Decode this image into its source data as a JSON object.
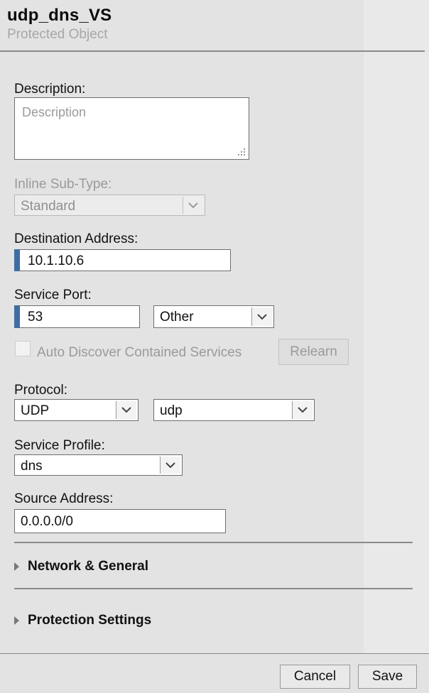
{
  "header": {
    "title": "udp_dns_VS",
    "subtitle": "Protected Object"
  },
  "description": {
    "label": "Description:",
    "placeholder": "Description",
    "value": ""
  },
  "inline_subtype": {
    "label": "Inline Sub-Type:",
    "value": "Standard",
    "disabled": true
  },
  "destination": {
    "label": "Destination Address:",
    "value": "10.1.10.6"
  },
  "service_port": {
    "label": "Service Port:",
    "value": "53",
    "select_value": "Other"
  },
  "auto_discover": {
    "label": "Auto Discover Contained Services",
    "button": "Relearn",
    "checked": false,
    "disabled": true
  },
  "protocol": {
    "label": "Protocol:",
    "value": "UDP",
    "sub_value": "udp"
  },
  "service_profile": {
    "label": "Service Profile:",
    "value": "dns"
  },
  "source": {
    "label": "Source Address:",
    "value": "0.0.0.0/0"
  },
  "sections": [
    {
      "label": "Network & General",
      "expanded": false
    },
    {
      "label": "Protection Settings",
      "expanded": false
    }
  ],
  "footer": {
    "cancel": "Cancel",
    "save": "Save"
  },
  "colors": {
    "required_marker": "#3c6ea3",
    "background": "#e3e3e3"
  },
  "icons": {
    "dropdown": "chevron-down-icon",
    "collapsed": "triangle-right-icon",
    "resize": "resize-grip-icon"
  }
}
